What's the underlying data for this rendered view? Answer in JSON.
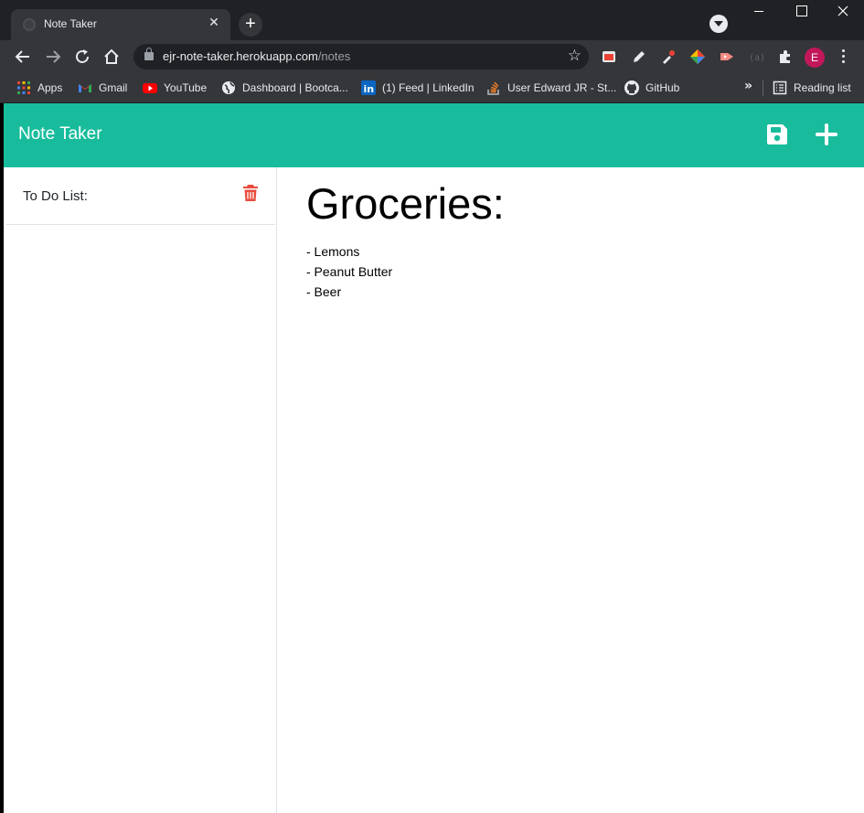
{
  "browser": {
    "tab_title": "Note Taker",
    "url_host": "ejr-note-taker.herokuapp.com",
    "url_path": "/notes",
    "profile_initial": "E",
    "bookmarks": [
      {
        "label": "Apps",
        "icon": "apps-grid-icon"
      },
      {
        "label": "Gmail",
        "icon": "gmail-icon"
      },
      {
        "label": "YouTube",
        "icon": "youtube-icon"
      },
      {
        "label": "Dashboard | Bootca...",
        "icon": "globe-icon"
      },
      {
        "label": "(1) Feed | LinkedIn",
        "icon": "linkedin-icon"
      },
      {
        "label": "User Edward JR - St...",
        "icon": "stackoverflow-icon"
      },
      {
        "label": "GitHub",
        "icon": "github-icon"
      }
    ],
    "reading_list": "Reading list"
  },
  "app": {
    "brand": "Note Taker",
    "accent_color": "#18bc9c",
    "delete_color": "#e74c3c",
    "notes": [
      {
        "title": "To Do List:"
      }
    ],
    "active_note": {
      "title": "Groceries:",
      "lines": [
        "- Lemons",
        "- Peanut Butter",
        "- Beer"
      ]
    }
  }
}
